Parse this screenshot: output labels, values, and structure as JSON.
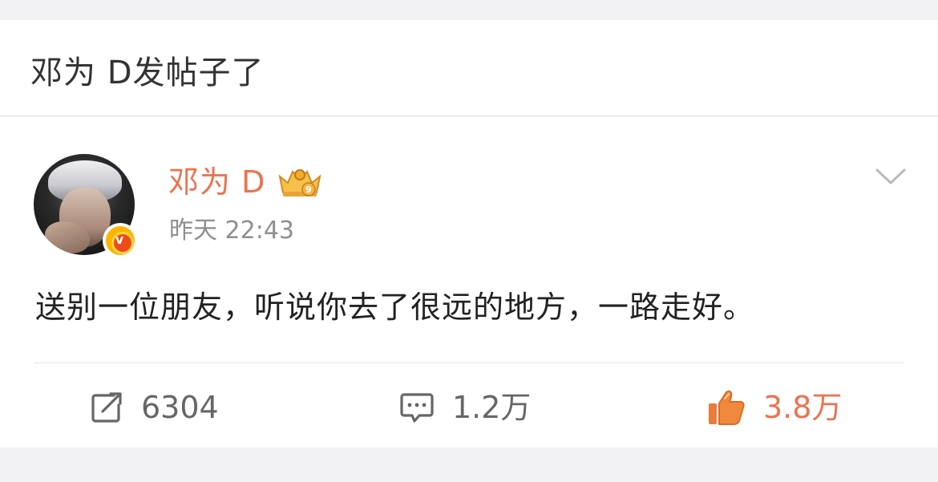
{
  "header": {
    "title": "邓为 D发帖子了"
  },
  "post": {
    "author": "邓为 D",
    "timestamp": "昨天 22:43",
    "text": "送别一位朋友，听说你去了很远的地方，一路走好。",
    "badge_icon": "crown-level-icon",
    "verified_icon": "verified-v-icon",
    "menu_icon": "chevron-down-icon"
  },
  "actions": {
    "repost": {
      "icon": "repost-icon",
      "count": "6304"
    },
    "comment": {
      "icon": "comment-icon",
      "count": "1.2万"
    },
    "like": {
      "icon": "thumbs-up-icon",
      "count": "3.8万"
    }
  },
  "colors": {
    "accent": "#eb7350",
    "text": "#222222",
    "secondary": "#8e8e93",
    "background": "#f2f2f4"
  }
}
